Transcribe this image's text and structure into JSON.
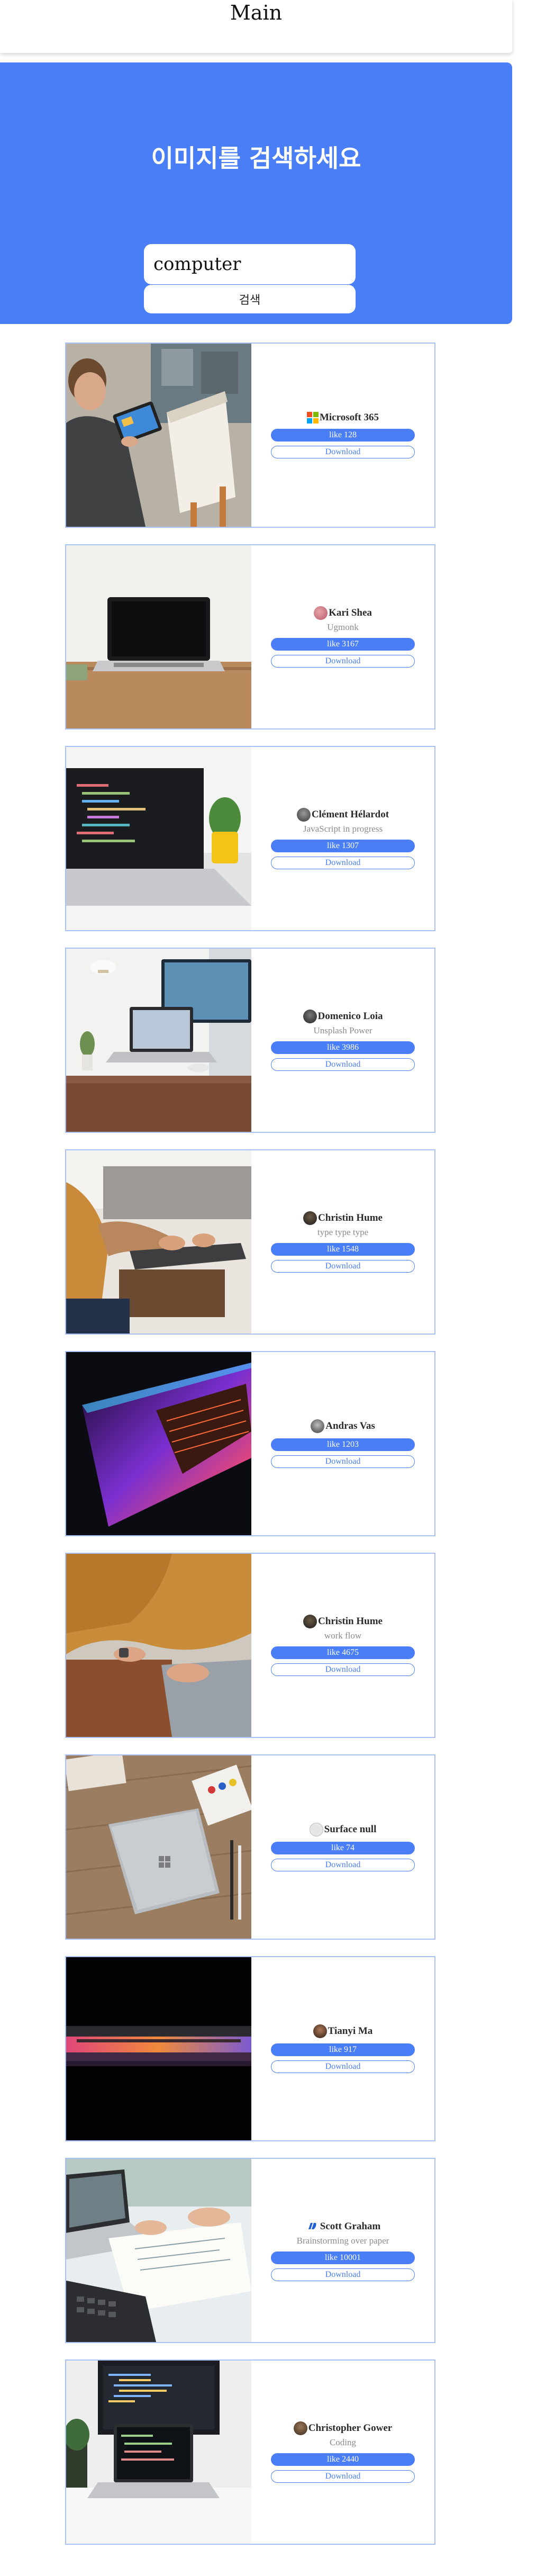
{
  "header": {
    "title": "Main"
  },
  "hero": {
    "title": "이미지를 검색하세요",
    "search_value": "computer",
    "search_button_label": "검색"
  },
  "colors": {
    "accent": "#4a7ef6",
    "card_border": "#a9c1f5"
  },
  "cards": [
    {
      "author": "Microsoft 365",
      "subtitle": "",
      "like": "like 128",
      "download": "Download",
      "avatar_icon": "microsoft-logo-icon"
    },
    {
      "author": "Kari Shea",
      "subtitle": "Ugmonk",
      "like": "like 3167",
      "download": "Download",
      "avatar_icon": "avatar-icon"
    },
    {
      "author": "Clément Hélardot",
      "subtitle": "JavaScript in progress",
      "like": "like 1307",
      "download": "Download",
      "avatar_icon": "avatar-icon"
    },
    {
      "author": "Domenico Loia",
      "subtitle": "Unsplash Power",
      "like": "like 3986",
      "download": "Download",
      "avatar_icon": "avatar-icon"
    },
    {
      "author": "Christin Hume",
      "subtitle": "type type type",
      "like": "like 1548",
      "download": "Download",
      "avatar_icon": "avatar-icon"
    },
    {
      "author": "Andras Vas",
      "subtitle": "",
      "like": "like 1203",
      "download": "Download",
      "avatar_icon": "avatar-icon"
    },
    {
      "author": "Christin Hume",
      "subtitle": "work flow",
      "like": "like 4675",
      "download": "Download",
      "avatar_icon": "avatar-icon"
    },
    {
      "author": "Surface null",
      "subtitle": "",
      "like": "like 74",
      "download": "Download",
      "avatar_icon": "avatar-icon"
    },
    {
      "author": "Tianyi Ma",
      "subtitle": "",
      "like": "like 917",
      "download": "Download",
      "avatar_icon": "avatar-icon"
    },
    {
      "author": "Scott Graham",
      "subtitle": "Brainstorming over paper",
      "like": "like 10001",
      "download": "Download",
      "avatar_icon": "avatar-icon"
    },
    {
      "author": "Christopher Gower",
      "subtitle": "Coding",
      "like": "like 2440",
      "download": "Download",
      "avatar_icon": "avatar-icon"
    }
  ]
}
